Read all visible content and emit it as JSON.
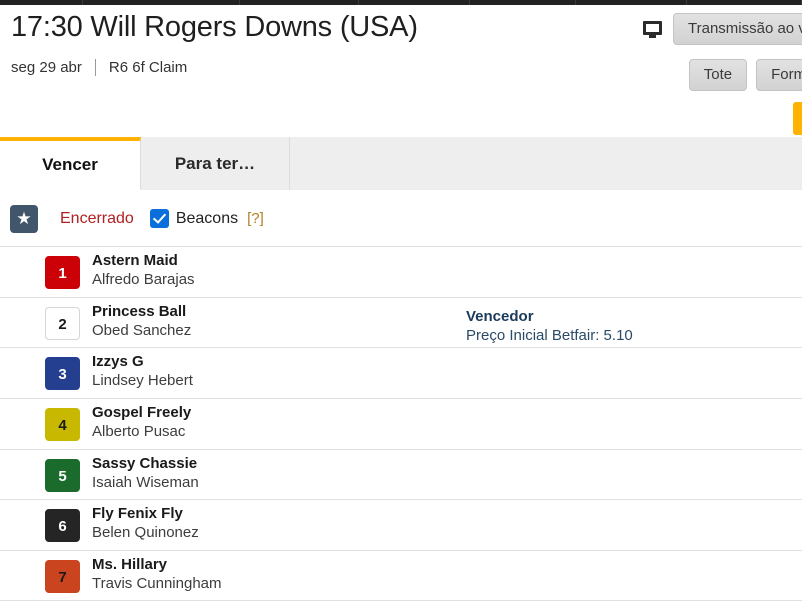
{
  "top_nav": {
    "cell_count": 7
  },
  "header": {
    "title": "17:30 Will Rogers Downs (USA)",
    "date": "seg 29 abr",
    "race_info": "R6 6f Claim",
    "live_stream_label": "Transmissão ao vivo",
    "tote_label": "Tote",
    "form_label": "Forma e",
    "tv_icon": "tv-monitor-icon",
    "orange_accent": "#ffb200"
  },
  "tabs": [
    {
      "label": "Vencer",
      "active": true
    },
    {
      "label": "Para ter…",
      "active": false
    }
  ],
  "status_bar": {
    "favourite_icon": "star-icon",
    "status_text": "Encerrado",
    "status_color": "#b02020",
    "beacons_label": "Beacons",
    "beacons_checked": true,
    "beacons_checkbox_color": "#0a6fdb",
    "help_label": "[?]"
  },
  "runners": [
    {
      "number": "1",
      "horse": "Astern Maid",
      "jockey": "Alfredo Barajas",
      "bg": "#cc0007",
      "fg": "#ffffff",
      "border": "#cc0007"
    },
    {
      "number": "2",
      "horse": "Princess Ball",
      "jockey": "Obed Sanchez",
      "bg": "#ffffff",
      "fg": "#1a1a1a",
      "border": "#d6d6d6"
    },
    {
      "number": "3",
      "horse": "Izzys G",
      "jockey": "Lindsey Hebert",
      "bg": "#243f8f",
      "fg": "#ffffff",
      "border": "#243f8f"
    },
    {
      "number": "4",
      "horse": "Gospel Freely",
      "jockey": "Alberto Pusac",
      "bg": "#c8b800",
      "fg": "#1a1a1a",
      "border": "#c8b800"
    },
    {
      "number": "5",
      "horse": "Sassy Chassie",
      "jockey": "Isaiah Wiseman",
      "bg": "#1b6b2c",
      "fg": "#ffffff",
      "border": "#1b6b2c"
    },
    {
      "number": "6",
      "horse": "Fly Fenix Fly",
      "jockey": "Belen Quinonez",
      "bg": "#252525",
      "fg": "#ffffff",
      "border": "#252525"
    },
    {
      "number": "7",
      "horse": "Ms. Hillary",
      "jockey": "Travis Cunningham",
      "bg": "#c9441f",
      "fg": "#1a1a1a",
      "border": "#c9441f"
    }
  ],
  "result": {
    "title": "Vencedor",
    "price_line": "Preço Inicial Betfair: 5.10"
  }
}
